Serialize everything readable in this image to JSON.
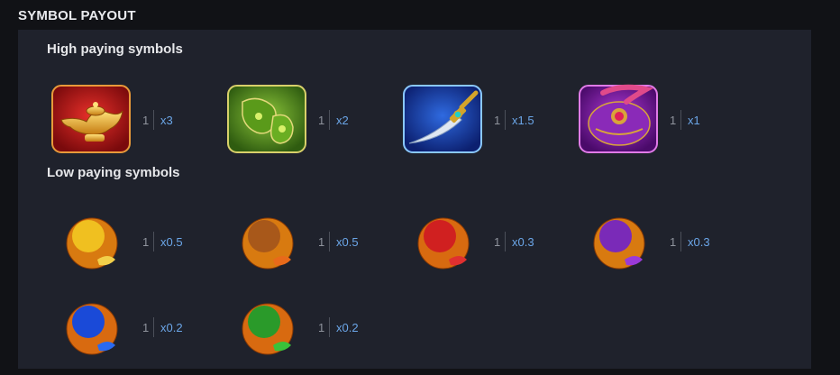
{
  "title": "SYMBOL PAYOUT",
  "sections": {
    "high_heading": "High paying symbols",
    "low_heading": "Low paying symbols"
  },
  "high_symbols": [
    {
      "icon": "golden-lamp-icon",
      "count": "1",
      "multiplier": "x3"
    },
    {
      "icon": "green-amulet-icon",
      "count": "1",
      "multiplier": "x2"
    },
    {
      "icon": "dagger-icon",
      "count": "1",
      "multiplier": "x1.5"
    },
    {
      "icon": "jeweled-turban-icon",
      "count": "1",
      "multiplier": "x1"
    }
  ],
  "low_symbols": [
    {
      "icon": "yellow-pomegranate-icon",
      "count": "1",
      "multiplier": "x0.5"
    },
    {
      "icon": "brown-pomegranate-icon",
      "count": "1",
      "multiplier": "x0.5"
    },
    {
      "icon": "red-pomegranate-icon",
      "count": "1",
      "multiplier": "x0.3"
    },
    {
      "icon": "purple-pomegranate-icon",
      "count": "1",
      "multiplier": "x0.3"
    },
    {
      "icon": "blue-pomegranate-icon",
      "count": "1",
      "multiplier": "x0.2"
    },
    {
      "icon": "green-pomegranate-icon",
      "count": "1",
      "multiplier": "x0.2"
    }
  ],
  "colors": {
    "background": "#111216",
    "panel": "#1f222c",
    "multiplier": "#6ba6e8",
    "count": "#8f939c"
  }
}
